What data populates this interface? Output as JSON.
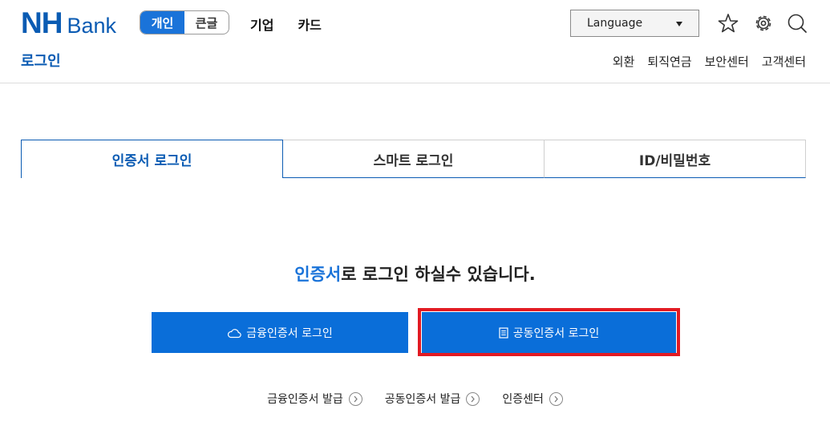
{
  "brand": {
    "nh": "NH",
    "bank": "Bank"
  },
  "mode_toggle": {
    "personal": "개인",
    "large_text": "큰글"
  },
  "topnav": {
    "corporate": "기업",
    "card": "카드"
  },
  "language": {
    "label": "Language"
  },
  "page_title": "로그인",
  "subnav": [
    "외환",
    "퇴직연금",
    "보안센터",
    "고객센터"
  ],
  "tabs": [
    "인증서 로그인",
    "스마트 로그인",
    "ID/비밀번호"
  ],
  "headline": {
    "highlight": "인증서",
    "rest": "로 로그인 하실수 있습니다."
  },
  "buttons": {
    "financial_cert": "금융인증서 로그인",
    "joint_cert": "공동인증서 로그인"
  },
  "links": [
    "금융인증서 발급",
    "공동인증서 발급",
    "인증센터"
  ],
  "colors": {
    "brand": "#0a5bb3",
    "button": "#0a6ed9",
    "highlight": "#e21a22"
  },
  "icons": [
    "star-icon",
    "gear-icon",
    "search-icon",
    "cloud-icon",
    "document-icon",
    "chevron-right-icon"
  ]
}
